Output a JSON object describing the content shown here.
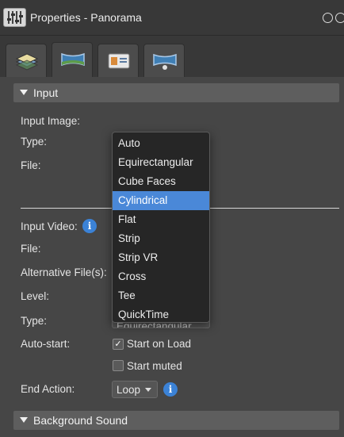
{
  "window": {
    "title": "Properties - Panorama"
  },
  "tabs": [
    {
      "icon": "layers-icon"
    },
    {
      "icon": "panorama-icon"
    },
    {
      "icon": "id-card-icon"
    },
    {
      "icon": "panorama-viewer-icon"
    }
  ],
  "input_section": {
    "header": "Input",
    "input_image_label": "Input Image:",
    "type_label": "Type:",
    "file_label": "File:"
  },
  "video": {
    "input_video_label": "Input Video:",
    "file_label": "File:",
    "alt_file_label": "Alternative File(s):",
    "level_label": "Level:",
    "type_label": "Type:",
    "type_value_partial": "Equirectangular",
    "autostart_label": "Auto-start:",
    "start_on_load": "Start on Load",
    "start_on_load_checked": true,
    "start_muted": "Start muted",
    "start_muted_checked": false,
    "end_action_label": "End Action:",
    "end_action_value": "Loop"
  },
  "type_dropdown": {
    "options": [
      "Auto",
      "Equirectangular",
      "Cube Faces",
      "Cylindrical",
      "Flat",
      "Strip",
      "Strip VR",
      "Cross",
      "Tee",
      "QuickTime"
    ],
    "selected": "Cylindrical"
  },
  "background_section": {
    "header": "Background Sound"
  },
  "colors": {
    "selection": "#4a88d8",
    "info": "#3b82d6"
  }
}
